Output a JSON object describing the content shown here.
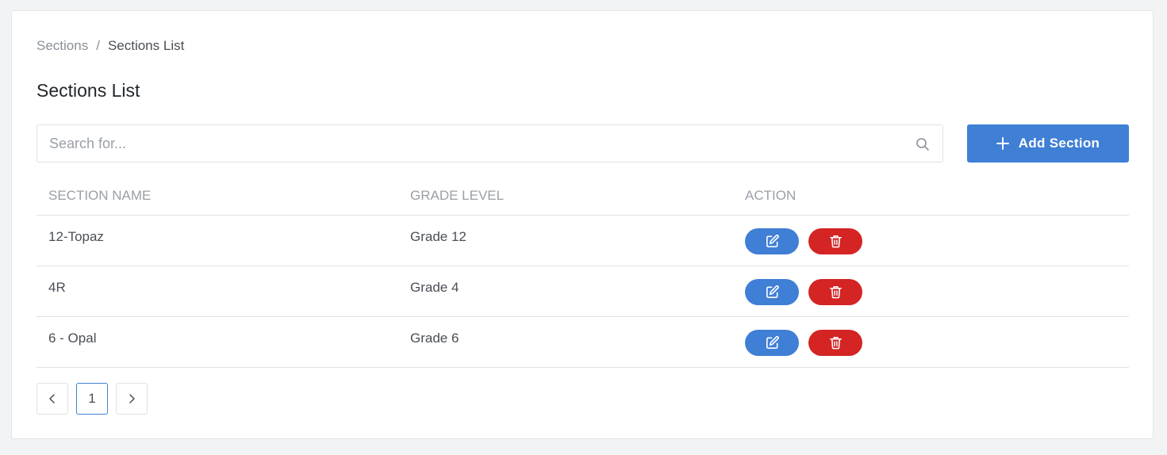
{
  "breadcrumb": {
    "parent": "Sections",
    "separator": "/",
    "current": "Sections List"
  },
  "page_title": "Sections List",
  "search": {
    "placeholder": "Search for...",
    "value": "",
    "icon": "search-icon"
  },
  "add_button": {
    "label": "Add Section",
    "icon": "plus-icon"
  },
  "table": {
    "headers": [
      "SECTION NAME",
      "GRADE LEVEL",
      "ACTION"
    ],
    "rows": [
      {
        "section_name": "12-Topaz",
        "grade_level": "Grade 12"
      },
      {
        "section_name": "4R",
        "grade_level": "Grade 4"
      },
      {
        "section_name": "6 - Opal",
        "grade_level": "Grade 6"
      }
    ],
    "action_icons": [
      "edit-icon",
      "trash-icon"
    ]
  },
  "pagination": {
    "prev_icon": "chevron-left-icon",
    "pages": [
      "1"
    ],
    "current_page": "1",
    "next_icon": "chevron-right-icon"
  },
  "colors": {
    "primary": "#3f7fd5",
    "danger": "#d42424",
    "background": "#f2f3f5",
    "card": "#ffffff"
  }
}
